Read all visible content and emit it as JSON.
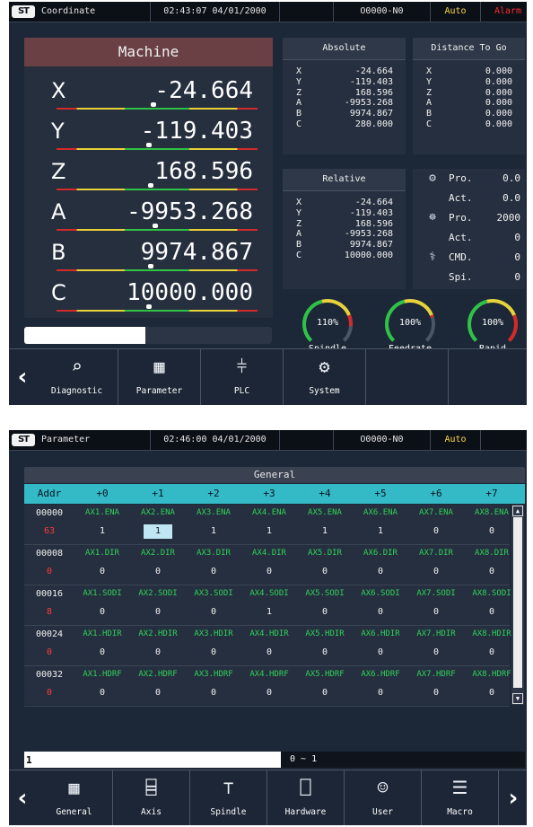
{
  "screen1": {
    "title": "Coordinate",
    "datetime": "02:43:07 04/01/2000",
    "program": "O0000-N0",
    "mode": "Auto",
    "alarm": "Alarm",
    "machine": {
      "header": "Machine",
      "axes": [
        {
          "name": "X",
          "value": "-24.664"
        },
        {
          "name": "Y",
          "value": "-119.403"
        },
        {
          "name": "Z",
          "value": "168.596"
        },
        {
          "name": "A",
          "value": "-9953.268"
        },
        {
          "name": "B",
          "value": "9974.867"
        },
        {
          "name": "C",
          "value": "10000.000"
        }
      ],
      "progress_fraction": 0.49
    },
    "absolute": {
      "header": "Absolute",
      "rows": [
        {
          "axis": "X",
          "value": "-24.664"
        },
        {
          "axis": "Y",
          "value": "-119.403"
        },
        {
          "axis": "Z",
          "value": "168.596"
        },
        {
          "axis": "A",
          "value": "-9953.268"
        },
        {
          "axis": "B",
          "value": "9974.867"
        },
        {
          "axis": "C",
          "value": "280.000"
        }
      ]
    },
    "distance_to_go": {
      "header": "Distance To Go",
      "rows": [
        {
          "axis": "X",
          "value": "0.000"
        },
        {
          "axis": "Y",
          "value": "0.000"
        },
        {
          "axis": "Z",
          "value": "0.000"
        },
        {
          "axis": "A",
          "value": "0.000"
        },
        {
          "axis": "B",
          "value": "0.000"
        },
        {
          "axis": "C",
          "value": "0.000"
        }
      ]
    },
    "relative": {
      "header": "Relative",
      "rows": [
        {
          "axis": "X",
          "value": "-24.664"
        },
        {
          "axis": "Y",
          "value": "-119.403"
        },
        {
          "axis": "Z",
          "value": "168.596"
        },
        {
          "axis": "A",
          "value": "-9953.268"
        },
        {
          "axis": "B",
          "value": "9974.867"
        },
        {
          "axis": "C",
          "value": "10000.000"
        }
      ]
    },
    "status": [
      {
        "label": "Pro.",
        "value": "0.0",
        "icon": "machine-feed-icon"
      },
      {
        "label": "Act.",
        "value": "0.0",
        "icon": ""
      },
      {
        "label": "Pro.",
        "value": "2000",
        "icon": "spindle-icon"
      },
      {
        "label": "Act.",
        "value": "0",
        "icon": ""
      },
      {
        "label": "CMD.",
        "value": "0",
        "icon": "tool-icon"
      },
      {
        "label": "Spi.",
        "value": "0",
        "icon": ""
      }
    ],
    "gauges": [
      {
        "label": "Spindle",
        "value": "110%",
        "fraction": 0.85
      },
      {
        "label": "Feedrate",
        "value": "100%",
        "fraction": 0.77
      },
      {
        "label": "Rapid",
        "value": "100%",
        "fraction": 1.0
      }
    ],
    "toolbar": [
      {
        "label": "Diagnostic",
        "icon": "diagnostic-icon"
      },
      {
        "label": "Parameter",
        "icon": "parameter-icon"
      },
      {
        "label": "PLC",
        "icon": "plc-icon"
      },
      {
        "label": "System",
        "icon": "system-icon"
      }
    ]
  },
  "screen2": {
    "title": "Parameter",
    "datetime": "02:46:00 04/01/2000",
    "program": "O0000-N0",
    "mode": "Auto",
    "section": "General",
    "columns": [
      "Addr",
      "+0",
      "+1",
      "+2",
      "+3",
      "+4",
      "+5",
      "+6",
      "+7"
    ],
    "groups": [
      {
        "addr": "00000",
        "dec": "63",
        "names": [
          "AX1.ENA",
          "AX2.ENA",
          "AX3.ENA",
          "AX4.ENA",
          "AX5.ENA",
          "AX6.ENA",
          "AX7.ENA",
          "AX8.ENA"
        ],
        "values": [
          "1",
          "1",
          "1",
          "1",
          "1",
          "1",
          "0",
          "0"
        ]
      },
      {
        "addr": "00008",
        "dec": "0",
        "names": [
          "AX1.DIR",
          "AX2.DIR",
          "AX3.DIR",
          "AX4.DIR",
          "AX5.DIR",
          "AX6.DIR",
          "AX7.DIR",
          "AX8.DIR"
        ],
        "values": [
          "0",
          "0",
          "0",
          "0",
          "0",
          "0",
          "0",
          "0"
        ]
      },
      {
        "addr": "00016",
        "dec": "8",
        "names": [
          "AX1.SODI",
          "AX2.SODI",
          "AX3.SODI",
          "AX4.SODI",
          "AX5.SODI",
          "AX6.SODI",
          "AX7.SODI",
          "AX8.SODI"
        ],
        "values": [
          "0",
          "0",
          "0",
          "1",
          "0",
          "0",
          "0",
          "0"
        ]
      },
      {
        "addr": "00024",
        "dec": "0",
        "names": [
          "AX1.HDIR",
          "AX2.HDIR",
          "AX3.HDIR",
          "AX4.HDIR",
          "AX5.HDIR",
          "AX6.HDIR",
          "AX7.HDIR",
          "AX8.HDIR"
        ],
        "values": [
          "0",
          "0",
          "0",
          "0",
          "0",
          "0",
          "0",
          "0"
        ]
      },
      {
        "addr": "00032",
        "dec": "0",
        "names": [
          "AX1.HDRF",
          "AX2.HDRF",
          "AX3.HDRF",
          "AX4.HDRF",
          "AX5.HDRF",
          "AX6.HDRF",
          "AX7.HDRF",
          "AX8.HDRF"
        ],
        "values": [
          "0",
          "0",
          "0",
          "0",
          "0",
          "0",
          "0",
          "0"
        ]
      }
    ],
    "input_value": "1",
    "range": "0 ~ 1",
    "toolbar": [
      {
        "label": "General",
        "icon": "general-icon"
      },
      {
        "label": "Axis",
        "icon": "axis-icon"
      },
      {
        "label": "Spindle",
        "icon": "spindle-icon"
      },
      {
        "label": "Hardware",
        "icon": "hardware-icon"
      },
      {
        "label": "User",
        "icon": "user-icon"
      },
      {
        "label": "Macro",
        "icon": "macro-icon"
      }
    ]
  },
  "colors": {
    "accent": "#34b9c7",
    "mode": "#ffd84a",
    "alarm": "#ff2b2b",
    "name_green": "#2fd259",
    "machine_header": "#6a4045"
  }
}
